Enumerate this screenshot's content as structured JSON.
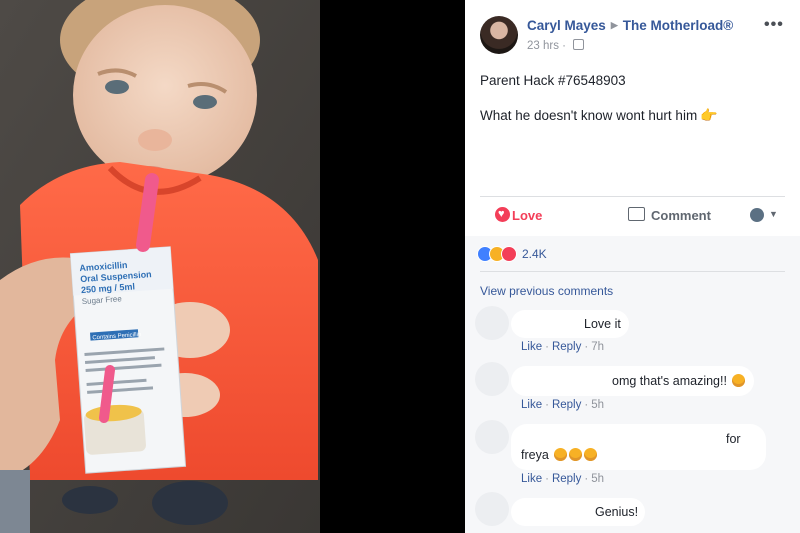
{
  "photo": {
    "box_title": "Amoxicillin",
    "box_subtitle": "Oral Suspension",
    "box_dose": "250 mg / 5ml",
    "box_note": "Sugar Free",
    "box_panel_label": "Contains Penicillin"
  },
  "post": {
    "author": "Caryl Mayes",
    "group": "The Motherload®",
    "time": "23 hrs",
    "line1": "Parent Hack #76548903",
    "line2": "What he doesn't know wont hurt him",
    "more_icon": "more-dots-icon"
  },
  "actions": {
    "love": "Love",
    "comment": "Comment"
  },
  "reactions": {
    "count": "2.4K"
  },
  "comments": {
    "view_previous": "View previous comments",
    "like_label": "Like",
    "reply_label": "Reply",
    "items": [
      {
        "text": "Love it",
        "time": "7h"
      },
      {
        "text": "omg that's amazing!!",
        "time": "5h"
      },
      {
        "text_a": "for",
        "text_b": "freya",
        "time": "5h"
      },
      {
        "text": "Genius!"
      }
    ]
  },
  "colors": {
    "link": "#365899",
    "love": "#f33e58",
    "shirt": "#ff5a3d",
    "straw": "#f05a8c"
  }
}
